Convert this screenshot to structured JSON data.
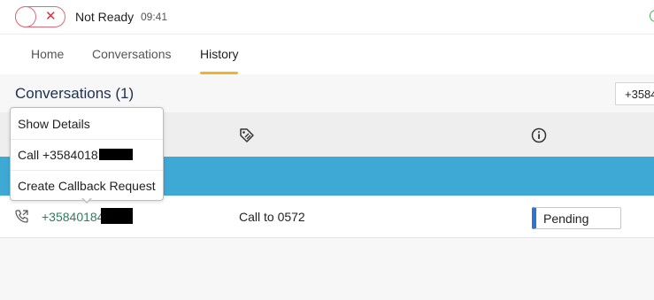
{
  "status": {
    "label": "Not Ready",
    "time": "09:41",
    "toggle_icon": "close-x-icon",
    "toggle_glyph": "✕",
    "colors": {
      "not_ready": "#d6323f",
      "indicator": "#4caf50"
    }
  },
  "tabs": [
    {
      "label": "Home",
      "active": false
    },
    {
      "label": "Conversations",
      "active": false
    },
    {
      "label": "History",
      "active": true
    }
  ],
  "main": {
    "title": "Conversations (1)",
    "search_value": "+3584",
    "header_icons": [
      "tag-icon",
      "info-icon"
    ]
  },
  "row": {
    "icon": "phone-outgoing-icon",
    "phone": "+35840184",
    "subject": "Call to 0572",
    "status": "Pending",
    "status_color": "#2d74d6",
    "highlight_color": "#3fa9d6"
  },
  "context_menu": {
    "items": [
      {
        "label": "Show Details"
      },
      {
        "label": "Call +3584018"
      },
      {
        "label": "Create Callback Request"
      }
    ]
  }
}
